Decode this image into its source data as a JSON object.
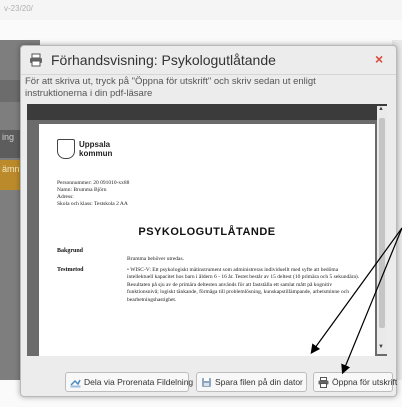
{
  "background": {
    "top_strip_text": "v-23/20/",
    "tab_b_label": "ing",
    "tab_c_label": "ämn"
  },
  "dialog": {
    "title": "Förhandsvisning: Psykologutlåtande",
    "close_symbol": "×",
    "instructions": "För att skriva ut, tryck på \"Öppna för utskrift\" och skriv sedan ut enligt instruktionerna i din pdf-läsare"
  },
  "document": {
    "logo_line1": "Uppsala",
    "logo_line2": "kommun",
    "personnummer": "Personnummer: 20 091010-xx88",
    "namn": "Namn: Brumma Björn",
    "adress": "Adress:",
    "skola": "Skola och klass: Testskola 2 AA",
    "heading": "PSYKOLOGUTLÅTANDE",
    "bakgrund_label": "Bakgrund",
    "bakgrund_text": "Brumma behöver utredas.",
    "testmetod_label": "Testmetod",
    "testmetod_text": "•   WISC-V: Ett psykologiskt mätinstrument som administreras individuellt med syfte att bedöma intellektuell kapacitet hos barn i åldern 6 - 16 år. Testet består av 15 deltest (10 primära och 5 sekundära). Resultaten på sju av de primära deltesten används för att fastställa ett samlat mått på kognitiv funktionsnivå; logiskt tänkande, förmåga till problemlösning, kunskapstillämpande, arbetsminne och bearbetningshastighet."
  },
  "footer": {
    "share_label": "Dela via Prorenata Fildelning",
    "save_label": "Spara filen på din dator",
    "open_print_label": "Öppna för utskrift"
  },
  "icons": {
    "printer": "printer-icon",
    "share": "share-icon",
    "save": "save-icon",
    "print": "print-icon"
  },
  "colors": {
    "close": "#d94a3d",
    "viewer_bg": "#6b6b6b",
    "annotation_arrow": "#000000"
  }
}
